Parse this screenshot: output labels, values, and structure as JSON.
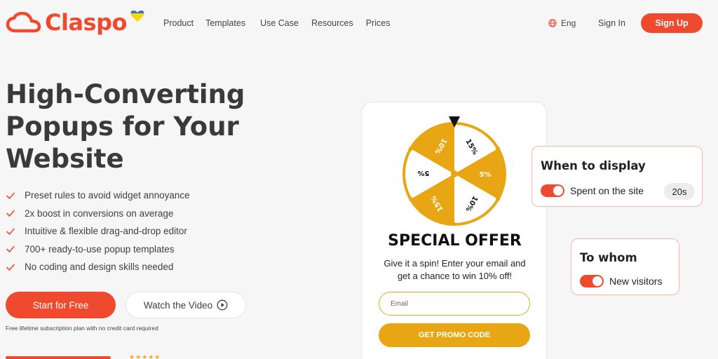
{
  "brand": {
    "name": "Claspo",
    "accent": "#f04a2e",
    "wheel_color": "#e8a614"
  },
  "nav": {
    "items": [
      "Product",
      "Templates",
      "Use Case",
      "Resources",
      "Prices"
    ]
  },
  "header": {
    "lang": "Eng",
    "signin": "Sign In",
    "signup": "Sign Up"
  },
  "hero": {
    "title_lines": [
      "High-Converting",
      "Popups for Your",
      "Website"
    ],
    "features": [
      "Preset rules to avoid widget annoyance",
      "2x boost in conversions on average",
      "Intuitive & flexible drag-and-drop editor",
      "700+ ready-to-use popup templates",
      "No coding and design skills needed"
    ],
    "start_btn": "Start for Free",
    "video_btn": "Watch the Video",
    "note": "Free lifetime subscription plan with no credit card required",
    "stars": "★★★★★"
  },
  "popup": {
    "wheel_labels": [
      "15%",
      "5%",
      "10%",
      "15%",
      "5%",
      "10%"
    ],
    "title": "SPECIAL OFFER",
    "desc_line1": "Give it a spin! Enter your email and",
    "desc_line2": "get a chance to win 10% off!",
    "email_placeholder": "Email",
    "cta": "GET PROMO CODE"
  },
  "when_card": {
    "title": "When to display",
    "label": "Spent on the site",
    "value": "20s"
  },
  "whom_card": {
    "title": "To whom",
    "label": "New visitors"
  }
}
